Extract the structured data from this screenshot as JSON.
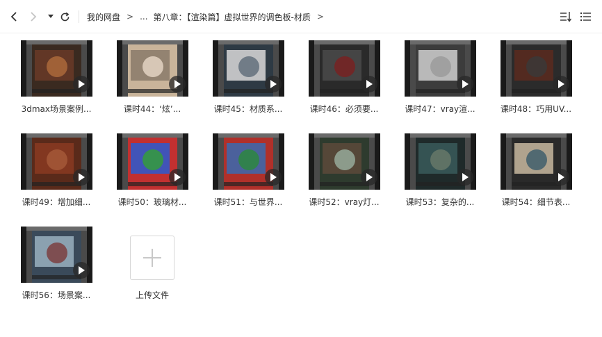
{
  "toolbar": {
    "back_icon": "chevron-left-icon",
    "forward_icon": "chevron-right-icon",
    "history_icon": "caret-down-icon",
    "refresh_icon": "refresh-icon",
    "sort_icon": "sort-icon",
    "view_icon": "list-view-icon"
  },
  "breadcrumb": {
    "items": [
      "我的网盘",
      "...",
      "第八章：【渲染篇】虚拟世界的调色板-材质"
    ],
    "separator": ">"
  },
  "files": [
    {
      "caption": "3dmax场景案例..."
    },
    {
      "caption": "课时44：‘炫’..."
    },
    {
      "caption": "课时45：材质系..."
    },
    {
      "caption": "课时46：必须要..."
    },
    {
      "caption": "课时47：vray渲..."
    },
    {
      "caption": "课时48：巧用UV..."
    },
    {
      "caption": "课时49：增加细..."
    },
    {
      "caption": "课时50：玻璃材..."
    },
    {
      "caption": "课时51：与世界..."
    },
    {
      "caption": "课时52：vray灯..."
    },
    {
      "caption": "课时53：复杂的..."
    },
    {
      "caption": "课时54：细节表..."
    },
    {
      "caption": "课时56：场景案..."
    }
  ],
  "upload": {
    "label": "上传文件",
    "icon": "plus-icon"
  },
  "colors": {
    "text": "#333333",
    "thumb_bg": "#1a1a1a",
    "border": "#d6d6d6"
  }
}
